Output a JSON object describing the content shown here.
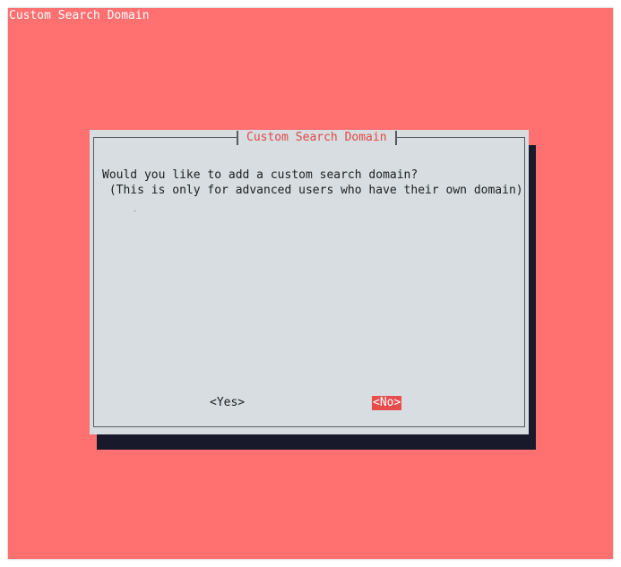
{
  "backtitle": "Custom Search Domain",
  "dialog": {
    "title": "Custom Search Domain",
    "message_line1": "Would you like to add a custom search domain?",
    "message_line2": " (This is only for advanced users who have their own domain)",
    "yes_label": "<Yes>",
    "no_label": "<No>",
    "selected_button": "No"
  },
  "colors": {
    "background": "#ff7070",
    "dialog": "#d7dde0",
    "accent": "#e84c4c",
    "shadow": "#181a2c"
  }
}
